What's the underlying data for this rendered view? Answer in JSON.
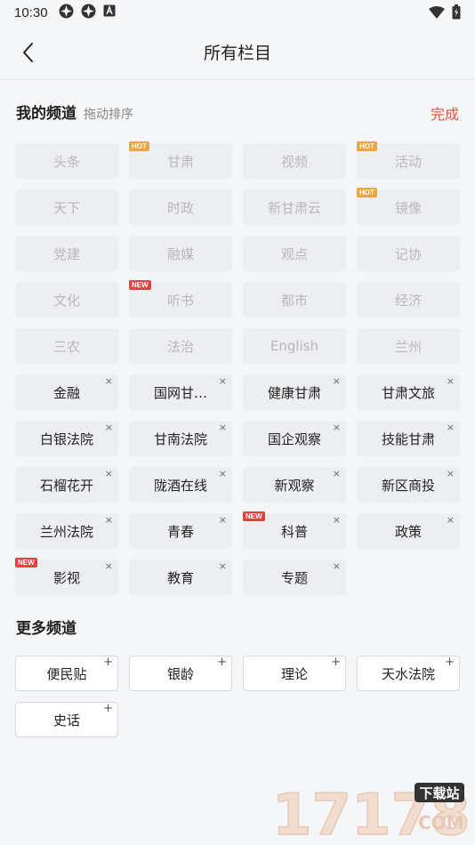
{
  "status_bar": {
    "time": "10:30"
  },
  "header": {
    "title": "所有栏目"
  },
  "my_channels": {
    "title": "我的频道",
    "hint": "拖动排序",
    "done_label": "完成",
    "fixed": [
      {
        "label": "头条",
        "badge": ""
      },
      {
        "label": "甘肃",
        "badge": "HOT"
      },
      {
        "label": "视频",
        "badge": ""
      },
      {
        "label": "活动",
        "badge": "HOT"
      },
      {
        "label": "天下",
        "badge": ""
      },
      {
        "label": "时政",
        "badge": ""
      },
      {
        "label": "新甘肃云",
        "badge": ""
      },
      {
        "label": "镜像",
        "badge": "HOT"
      },
      {
        "label": "党建",
        "badge": ""
      },
      {
        "label": "融媒",
        "badge": ""
      },
      {
        "label": "观点",
        "badge": ""
      },
      {
        "label": "记协",
        "badge": ""
      },
      {
        "label": "文化",
        "badge": ""
      },
      {
        "label": "听书",
        "badge": "NEW"
      },
      {
        "label": "都市",
        "badge": ""
      },
      {
        "label": "经济",
        "badge": ""
      },
      {
        "label": "三农",
        "badge": ""
      },
      {
        "label": "法治",
        "badge": ""
      },
      {
        "label": "English",
        "badge": ""
      },
      {
        "label": "兰州",
        "badge": ""
      }
    ],
    "removable": [
      {
        "label": "金融",
        "badge": ""
      },
      {
        "label": "国网甘…",
        "badge": ""
      },
      {
        "label": "健康甘肃",
        "badge": ""
      },
      {
        "label": "甘肃文旅",
        "badge": ""
      },
      {
        "label": "白银法院",
        "badge": ""
      },
      {
        "label": "甘南法院",
        "badge": ""
      },
      {
        "label": "国企观察",
        "badge": ""
      },
      {
        "label": "技能甘肃",
        "badge": ""
      },
      {
        "label": "石榴花开",
        "badge": ""
      },
      {
        "label": "陇酒在线",
        "badge": ""
      },
      {
        "label": "新观察",
        "badge": ""
      },
      {
        "label": "新区商投",
        "badge": ""
      },
      {
        "label": "兰州法院",
        "badge": ""
      },
      {
        "label": "青春",
        "badge": ""
      },
      {
        "label": "科普",
        "badge": "NEW"
      },
      {
        "label": "政策",
        "badge": ""
      },
      {
        "label": "影视",
        "badge": "NEW"
      },
      {
        "label": "教育",
        "badge": ""
      },
      {
        "label": "专题",
        "badge": ""
      }
    ]
  },
  "more_channels": {
    "title": "更多频道",
    "items": [
      {
        "label": "便民贴"
      },
      {
        "label": "银龄"
      },
      {
        "label": "理论"
      },
      {
        "label": "天水法院"
      },
      {
        "label": "史话"
      }
    ]
  },
  "watermark": {
    "number": "17178",
    "badge": "下载站",
    "suffix": "COM"
  },
  "colors": {
    "accent": "#e2523b",
    "hot_badge": "#f2a33a",
    "new_badge": "#e84040",
    "background": "#f5f6f8"
  }
}
